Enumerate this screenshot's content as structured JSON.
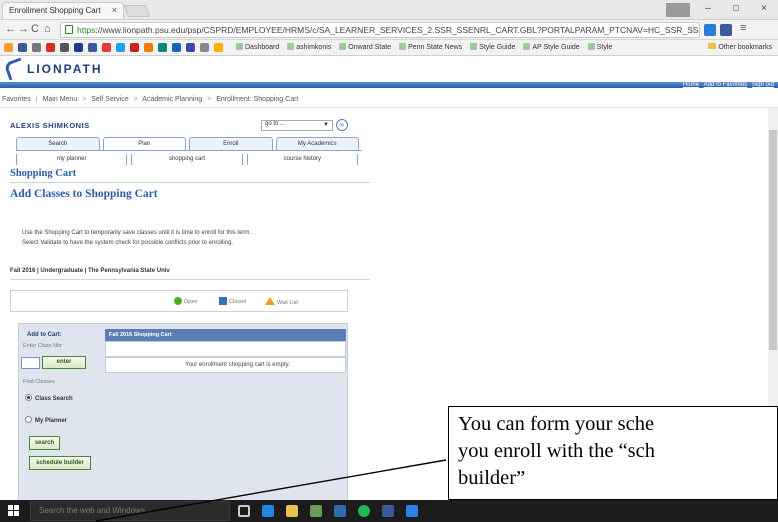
{
  "browser": {
    "tab_title": "Enrollment Shopping Cart",
    "tab_close": "×",
    "url_https": "https",
    "url_rest": "://www.lionpath.psu.edu/psp/CSPRD/EMPLOYEE/HRMS/c/SA_LEARNER_SERVICES_2.SSR_SSENRL_CART.GBL?PORTALPARAM_PTCNAV=HC_SSR_SSENRL",
    "window_controls": [
      "–",
      "□",
      "×"
    ],
    "bookmarks": [
      "Dashboard",
      "ashimkonis",
      "Onward State",
      "Penn State News",
      "Style Guide",
      "AP Style Guide",
      "Style"
    ],
    "other_bookmarks": "Other bookmarks"
  },
  "lionpath": {
    "logo_text": "LIONPATH",
    "header_links": [
      "Home",
      "Add to Favorites",
      "Sign out"
    ],
    "breadcrumb": [
      "Favorites",
      "Main Menu",
      "Self Service",
      "Academic Planning",
      "Enrollment: Shopping Cart"
    ],
    "student_name": "ALEXIS SHIMKONIS",
    "goto_label": "go to ...",
    "main_tabs": [
      "Search",
      "Plan",
      "Enroll",
      "My Academics"
    ],
    "sub_tabs": [
      "my planner",
      "shopping cart",
      "course history"
    ],
    "page_heading": "Shopping Cart",
    "section_heading": "Add Classes to Shopping Cart",
    "instructions": [
      "Use the Shopping Cart to temporarily save classes until it is time to enroll for this term.",
      "Select Validate to have the system check for possible conflicts prior to enrolling."
    ],
    "term_line": "Fall 2016 | Undergraduate | The Pennsylvania State Univ",
    "legend": {
      "open": "Open",
      "closed": "Closed",
      "wait_list": "Wait List"
    },
    "add_panel": {
      "title": "Add to Cart:",
      "enter_class_nbr": "Enter Class Nbr",
      "enter_button": "enter",
      "find_classes": "Find Classes",
      "radio_class_search": "Class Search",
      "radio_my_planner": "My Planner",
      "search_button": "search",
      "schedule_builder_button": "schedule builder"
    },
    "cart": {
      "header": "Fall 2016 Shopping Cart",
      "empty_message": "Your enrollment shopping cart is empty."
    }
  },
  "taskbar": {
    "search_placeholder": "Search the web and Windows"
  },
  "annotation": {
    "callout_text": "You can form your sche\nyou enroll with the “sch\nbuilder”"
  },
  "colors": {
    "brand_blue": "#2b5ca8",
    "open_green": "#4caf2b",
    "closed_blue": "#3b6fc2",
    "waitlist_orange": "#e5a21a",
    "button_green": "#4a8a2a"
  }
}
